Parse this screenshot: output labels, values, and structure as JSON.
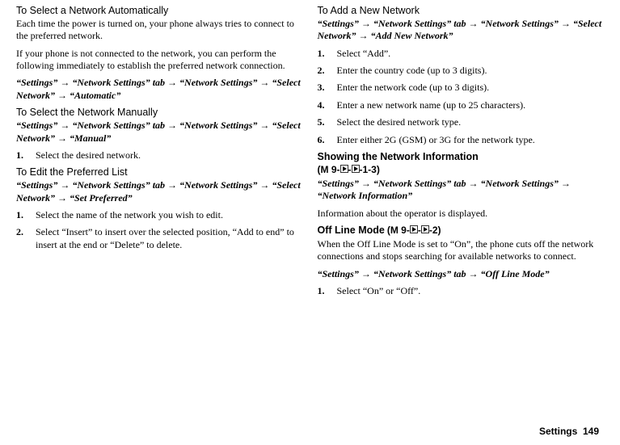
{
  "left": {
    "h1": "To Select a Network Automatically",
    "p1": "Each time the power is turned on, your phone always tries to connect to the preferred network.",
    "p2": "If your phone is not connected to the network, you can perform the following immediately to establish the preferred network connection.",
    "path1": "“Settings” → “Network Settings” tab → “Network Settings” → “Select Network” → “Automatic”",
    "h2": "To Select the Network Manually",
    "path2": "“Settings” → “Network Settings” tab → “Network Settings” → “Select Network” → “Manual”",
    "step_manual_1": "Select the desired network.",
    "h3": "To Edit the Preferred List",
    "path3": "“Settings” → “Network Settings” tab → “Network Settings” → “Select Network” → “Set Preferred”",
    "step_edit_1": "Select the name of the network you wish to edit.",
    "step_edit_2": "Select “Insert” to insert over the selected position, “Add to end” to insert at the end or “Delete” to delete."
  },
  "right": {
    "h1": "To Add a New Network",
    "path1": "“Settings” → “Network Settings” tab → “Network Settings” → “Select Network” → “Add New Network”",
    "s1": "Select “Add”.",
    "s2": "Enter the country code (up to 3 digits).",
    "s3": "Enter the network code (up to 3 digits).",
    "s4": "Enter a new network name (up to 25 characters).",
    "s5": "Select the desired network type.",
    "s6": "Enter either 2G (GSM) or 3G for the network type.",
    "h2": "Showing the Network Information",
    "code2a": " (M 9-",
    "code2b": "-",
    "code2c": "-1-3)",
    "path2": "“Settings” → “Network Settings” tab → “Network Settings” → “Network Information”",
    "p_info": "Information about the operator is displayed.",
    "h3": "Off Line Mode",
    "code3a": " (M 9-",
    "code3b": "-",
    "code3c": "-2)",
    "p_off": "When the Off Line Mode is set to “On”, the phone cuts off the network connections and stops searching for available networks to connect.",
    "path3": "“Settings” → “Network Settings” tab → “Off Line Mode”",
    "s_off_1": "Select “On” or “Off”."
  },
  "footer": {
    "section": "Settings",
    "page": "149"
  },
  "icons": {
    "triangle": "▶"
  }
}
